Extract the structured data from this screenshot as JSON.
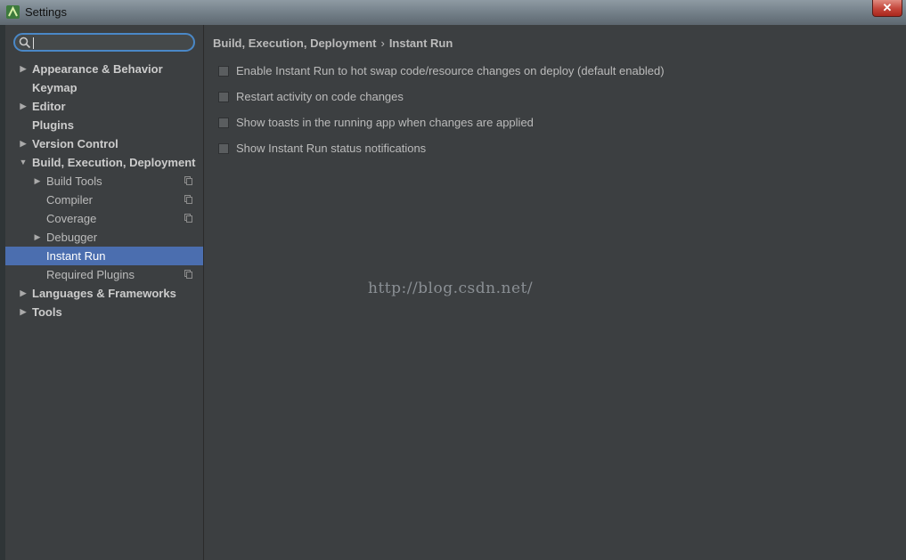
{
  "window": {
    "title": "Settings",
    "close_label": "✕"
  },
  "search": {
    "value": "",
    "placeholder": ""
  },
  "sidebar": {
    "items": [
      {
        "label": "Appearance & Behavior",
        "expanded": false
      },
      {
        "label": "Keymap"
      },
      {
        "label": "Editor",
        "expanded": false
      },
      {
        "label": "Plugins"
      },
      {
        "label": "Version Control",
        "expanded": false
      },
      {
        "label": "Build, Execution, Deployment",
        "expanded": true
      },
      {
        "label": "Build Tools",
        "expanded": false,
        "project_icon": true
      },
      {
        "label": "Compiler",
        "project_icon": true
      },
      {
        "label": "Coverage",
        "project_icon": true
      },
      {
        "label": "Debugger",
        "expanded": false
      },
      {
        "label": "Instant Run",
        "selected": true
      },
      {
        "label": "Required Plugins",
        "project_icon": true
      },
      {
        "label": "Languages & Frameworks",
        "expanded": false
      },
      {
        "label": "Tools",
        "expanded": false
      }
    ]
  },
  "main": {
    "breadcrumb": {
      "parent": "Build, Execution, Deployment",
      "separator": "›",
      "current": "Instant Run"
    },
    "options": [
      {
        "label": "Enable Instant Run to hot swap code/resource changes on deploy (default enabled)",
        "checked": false
      },
      {
        "label": "Restart activity on code changes",
        "checked": false
      },
      {
        "label": "Show toasts in the running app when changes are applied",
        "checked": false
      },
      {
        "label": "Show Instant Run status notifications",
        "checked": false
      }
    ]
  },
  "watermark": "http://blog.csdn.net/",
  "colors": {
    "background": "#3c3f41",
    "selection": "#4b6eaf",
    "search_focus": "#4a88c7"
  }
}
